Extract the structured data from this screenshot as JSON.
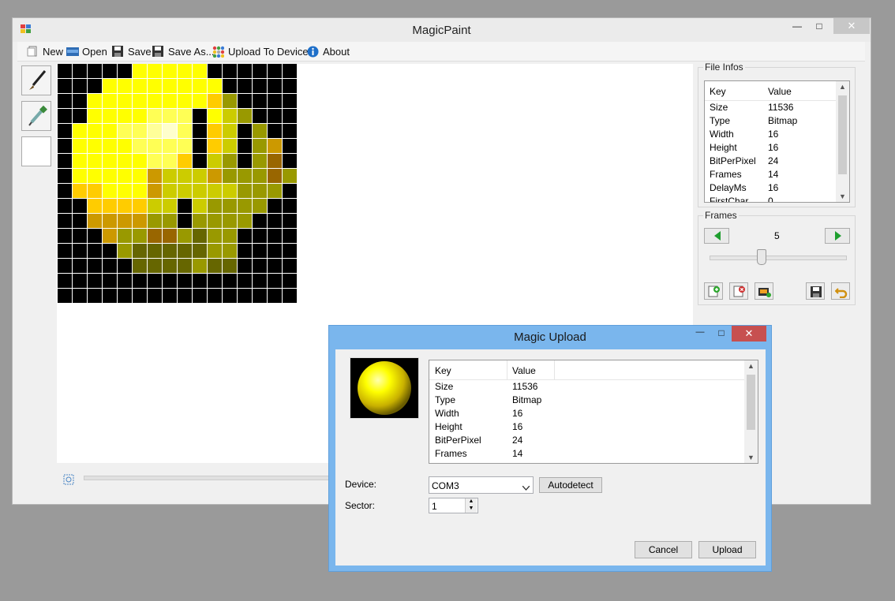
{
  "main_window": {
    "title": "MagicPaint",
    "minimize": "—",
    "maximize": "□",
    "close": "✕"
  },
  "toolbar": {
    "items": [
      {
        "label": "New",
        "icon": "new-file-icon"
      },
      {
        "label": "Open",
        "icon": "open-folder-icon"
      },
      {
        "label": "Save",
        "icon": "floppy-icon"
      },
      {
        "label": "Save As...",
        "icon": "floppy-icon"
      },
      {
        "label": "Upload To Device",
        "icon": "upload-grid-icon"
      },
      {
        "label": "About",
        "icon": "info-icon"
      }
    ]
  },
  "tools": [
    "brush-icon",
    "eyedropper-icon",
    "color-swatch"
  ],
  "canvas": {
    "palette": {
      "K": "#000000",
      "Y": "#ffff00",
      "y": "#ffff55",
      "L": "#ffff99",
      "W": "#ffffcc",
      "G": "#ffcc00",
      "O": "#cc9900",
      "B": "#996600",
      "A": "#999900",
      "D": "#666600",
      "C": "#cccc00"
    },
    "rows": [
      "KKKKKYYYYYKKKKKK",
      "KKKYYYYYYYYKKKKK",
      "KKYYYYYYYYGAKKKK",
      "KKYYYYyyyKYCAKKK",
      "KYYYyyLWyKGCKAKK",
      "KYYYYyyyyKGCKAOK",
      "KYYYYYyyGKCAKABK",
      "KYYYYYOCCCOAAABA",
      "KGGYYYOCCCCCAAAK",
      "KKGGGGCCKCAAAAKK",
      "KKOOOOAAKAAAAKKK",
      "KKKOAABBADAAKKKK",
      "KKKKADDDDDAAKKKK",
      "KKKKKDDDDADDKKKK",
      "KKKKKKKKKKKKKKKK",
      "KKKKKKKKKKKKKKKK"
    ]
  },
  "file_infos": {
    "group_label": "File Infos",
    "columns": [
      "Key",
      "Value"
    ],
    "rows": [
      {
        "key": "Size",
        "value": "11536"
      },
      {
        "key": "Type",
        "value": "Bitmap"
      },
      {
        "key": "Width",
        "value": "16"
      },
      {
        "key": "Height",
        "value": "16"
      },
      {
        "key": "BitPerPixel",
        "value": "24"
      },
      {
        "key": "Frames",
        "value": "14"
      },
      {
        "key": "DelayMs",
        "value": "16"
      },
      {
        "key": "FirstChar",
        "value": "0"
      }
    ]
  },
  "frames": {
    "group_label": "Frames",
    "current": "5",
    "slider_fraction": 0.38
  },
  "dialog": {
    "title": "Magic Upload",
    "minimize": "—",
    "maximize": "□",
    "close": "✕",
    "columns": [
      "Key",
      "Value"
    ],
    "rows": [
      {
        "key": "Size",
        "value": "11536"
      },
      {
        "key": "Type",
        "value": "Bitmap"
      },
      {
        "key": "Width",
        "value": "16"
      },
      {
        "key": "Height",
        "value": "16"
      },
      {
        "key": "BitPerPixel",
        "value": "24"
      },
      {
        "key": "Frames",
        "value": "14"
      }
    ],
    "device_label": "Device:",
    "device_value": "COM3",
    "autodetect_label": "Autodetect",
    "sector_label": "Sector:",
    "sector_value": "1",
    "cancel_label": "Cancel",
    "upload_label": "Upload"
  }
}
